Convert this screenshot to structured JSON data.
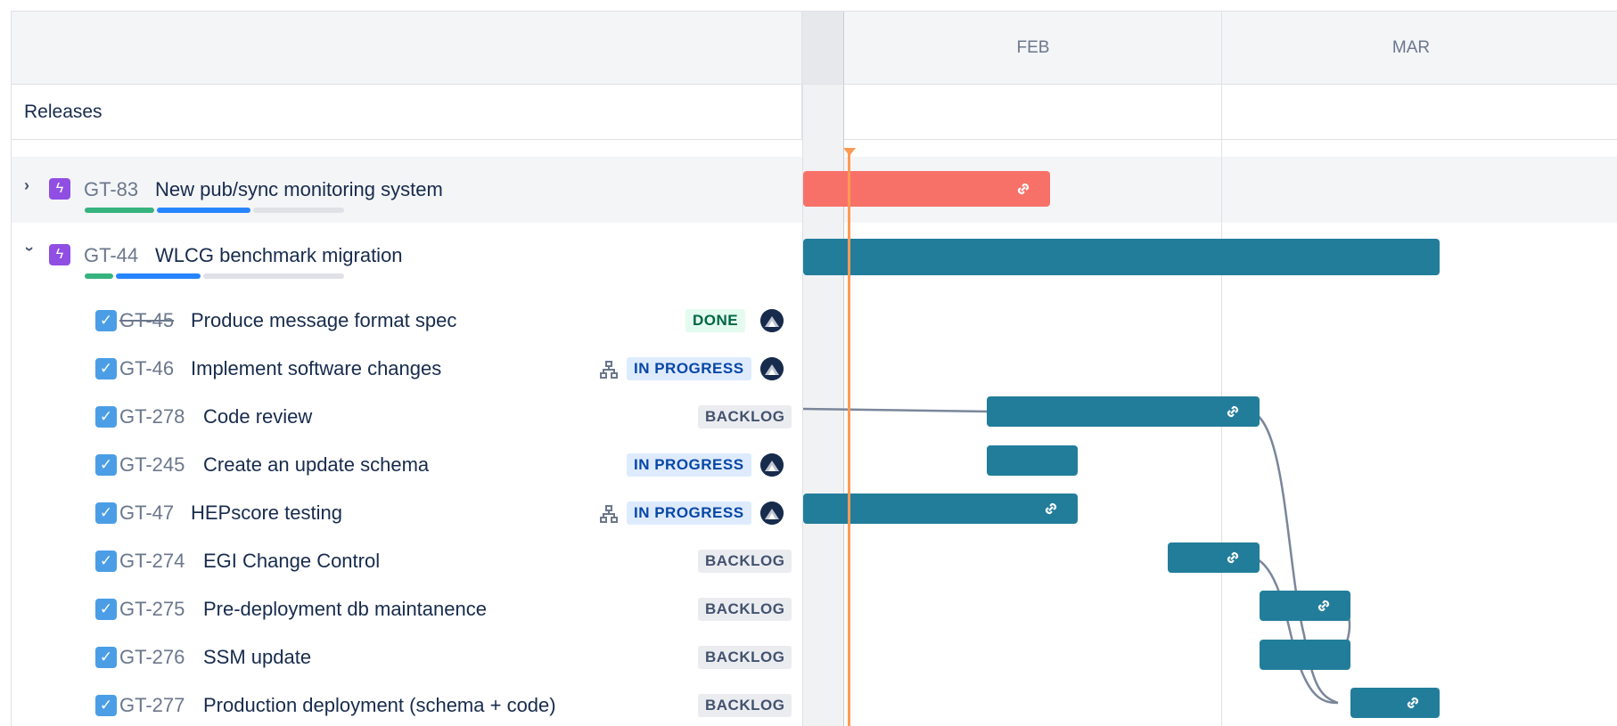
{
  "timeline": {
    "months": [
      "FEB",
      "MAR"
    ]
  },
  "releases": {
    "label": "Releases"
  },
  "epics": [
    {
      "key": "GT-83",
      "summary": "New pub/sync monitoring system",
      "expanded": false,
      "icon": "lightning-icon"
    },
    {
      "key": "GT-44",
      "summary": "WLCG benchmark migration",
      "expanded": true,
      "icon": "lightning-icon"
    }
  ],
  "issues": [
    {
      "key": "GT-45",
      "summary": "Produce message format spec",
      "status": "DONE",
      "has_assignee": true,
      "has_children": false
    },
    {
      "key": "GT-46",
      "summary": "Implement software changes",
      "status": "IN PROGRESS",
      "has_assignee": true,
      "has_children": true
    },
    {
      "key": "GT-278",
      "summary": "Code review",
      "status": "BACKLOG",
      "has_assignee": false,
      "has_children": false
    },
    {
      "key": "GT-245",
      "summary": "Create an update schema",
      "status": "IN PROGRESS",
      "has_assignee": true,
      "has_children": false
    },
    {
      "key": "GT-47",
      "summary": "HEPscore testing",
      "status": "IN PROGRESS",
      "has_assignee": true,
      "has_children": true
    },
    {
      "key": "GT-274",
      "summary": "EGI Change Control",
      "status": "BACKLOG",
      "has_assignee": false,
      "has_children": false
    },
    {
      "key": "GT-275",
      "summary": "Pre-deployment db maintanence",
      "status": "BACKLOG",
      "has_assignee": false,
      "has_children": false
    },
    {
      "key": "GT-276",
      "summary": "SSM update",
      "status": "BACKLOG",
      "has_assignee": false,
      "has_children": false
    },
    {
      "key": "GT-277",
      "summary": "Production deployment (schema + code)",
      "status": "BACKLOG",
      "has_assignee": false,
      "has_children": false
    }
  ],
  "colors": {
    "epic_red": "#f87168",
    "bar_teal": "#227d9b",
    "progress_done": "#36b37e",
    "progress_inprogress": "#2684ff",
    "progress_todo": "#dfe1e6",
    "today": "#ff9a55"
  }
}
